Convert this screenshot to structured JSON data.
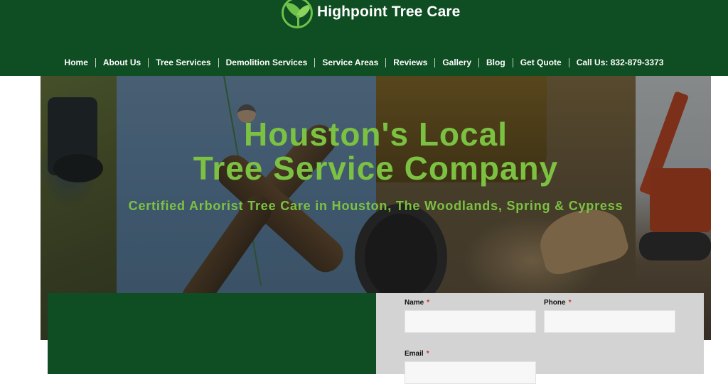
{
  "header": {
    "brand_name": "Highpoint Tree Care",
    "nav": [
      {
        "label": "Home"
      },
      {
        "label": "About Us"
      },
      {
        "label": "Tree Services"
      },
      {
        "label": "Demolition Services"
      },
      {
        "label": "Service Areas"
      },
      {
        "label": "Reviews"
      },
      {
        "label": "Gallery"
      },
      {
        "label": "Blog"
      },
      {
        "label": "Get Quote"
      },
      {
        "label": "Call Us: 832-879-3373"
      }
    ]
  },
  "hero": {
    "title_line1": "Houston's Local",
    "title_line2": "Tree Service Company",
    "subtitle": "Certified Arborist Tree Care in Houston, The Woodlands, Spring & Cypress"
  },
  "form": {
    "name_label": "Name",
    "phone_label": "Phone",
    "email_label": "Email",
    "required_mark": "*",
    "name_value": "",
    "phone_value": "",
    "email_value": ""
  },
  "colors": {
    "brand_green": "#0f4d22",
    "accent_green": "#7cc242",
    "required_red": "#d8282a"
  }
}
